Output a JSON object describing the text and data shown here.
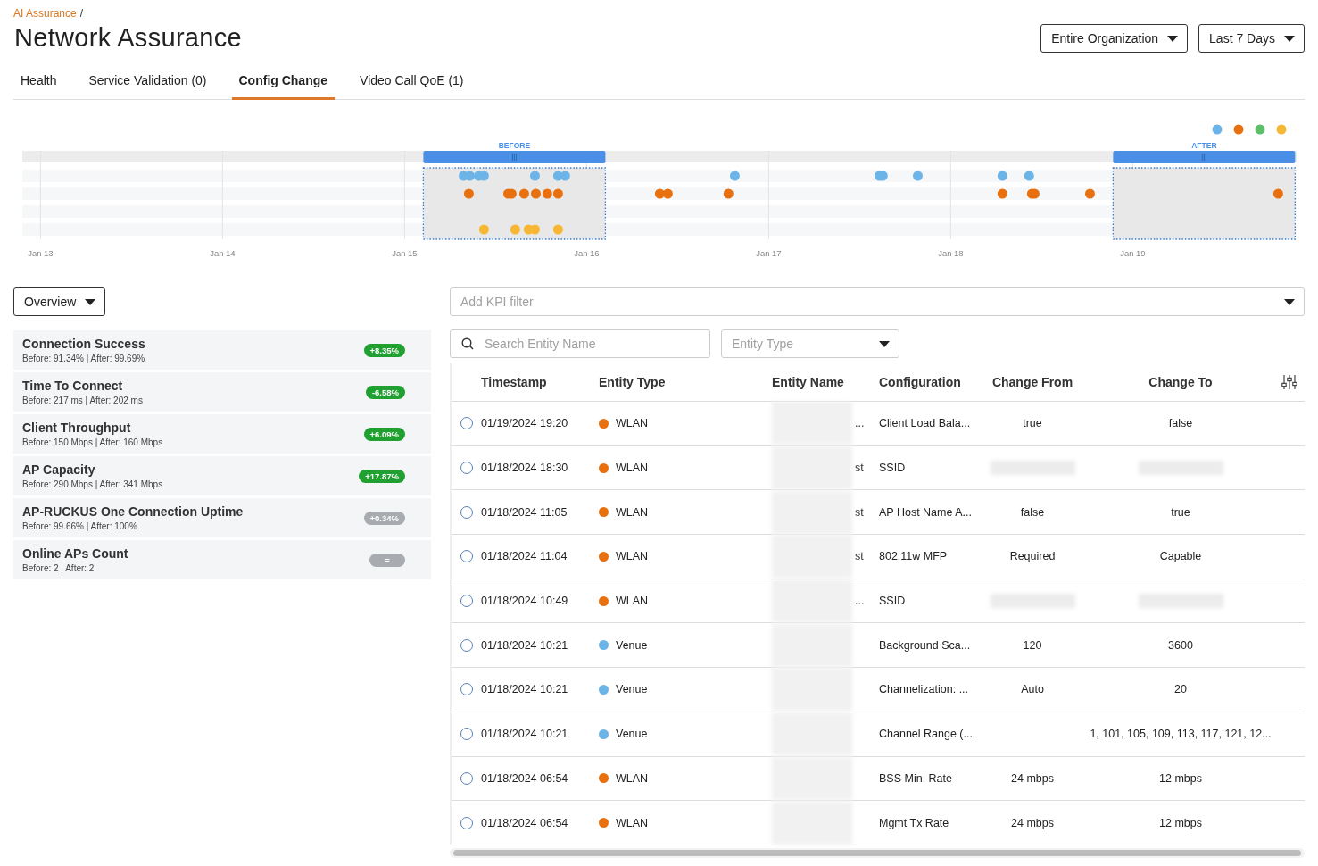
{
  "breadcrumb": {
    "link": "AI Assurance",
    "separator": "/"
  },
  "title": "Network Assurance",
  "scope_dropdowns": [
    {
      "label": "Entire Organization"
    },
    {
      "label": "Last 7 Days"
    }
  ],
  "tabs": [
    {
      "label": "Health",
      "selected": false
    },
    {
      "label": "Service Validation (0)",
      "selected": false
    },
    {
      "label": "Config Change",
      "selected": true
    },
    {
      "label": "Video Call QoE (1)",
      "selected": false
    }
  ],
  "timeline": {
    "legend": [
      {
        "color": "#6cb4e8"
      },
      {
        "color": "#e8700f"
      },
      {
        "color": "#5cbf6a"
      },
      {
        "color": "#f7b733"
      }
    ],
    "tick_labels": [
      "Jan 13",
      "Jan 14",
      "Jan 15",
      "Jan 16",
      "Jan 17",
      "Jan 18",
      "Jan 19"
    ],
    "ranges": [
      {
        "label": "BEFORE"
      },
      {
        "label": "AFTER"
      }
    ]
  },
  "view_dropdown": {
    "label": "Overview"
  },
  "kpis": [
    {
      "name": "Connection Success",
      "detail": "Before: 91.34% | After: 99.69%",
      "change": "+8.35%",
      "kind": "positive"
    },
    {
      "name": "Time To Connect",
      "detail": "Before: 217 ms | After: 202 ms",
      "change": "-6.58%",
      "kind": "positive"
    },
    {
      "name": "Client Throughput",
      "detail": "Before: 150 Mbps | After: 160 Mbps",
      "change": "+6.09%",
      "kind": "positive"
    },
    {
      "name": "AP Capacity",
      "detail": "Before: 290 Mbps | After: 341 Mbps",
      "change": "+17.87%",
      "kind": "positive"
    },
    {
      "name": "AP-RUCKUS One Connection Uptime",
      "detail": "Before: 99.66% | After: 100%",
      "change": "+0.34%",
      "kind": "neutral"
    },
    {
      "name": "Online APs Count",
      "detail": "Before: 2 | After: 2",
      "change": "=",
      "kind": "neutral"
    }
  ],
  "kpi_filter": {
    "placeholder": "Add KPI filter"
  },
  "search": {
    "placeholder": "Search Entity Name"
  },
  "entity_type_filter": {
    "placeholder": "Entity Type"
  },
  "table": {
    "columns": [
      "Timestamp",
      "Entity Type",
      "Entity Name",
      "Configuration",
      "Change From",
      "Change To"
    ],
    "rows": [
      {
        "selected": false,
        "timestamp": "01/19/2024 19:20",
        "entity_type": "WLAN",
        "color": "#e8700f",
        "entity_name_tail": "...",
        "configuration": "Client Load Bala...",
        "change_from": {
          "kind": "text",
          "text": "true"
        },
        "change_to": {
          "kind": "text",
          "text": "false"
        }
      },
      {
        "selected": false,
        "timestamp": "01/18/2024 18:30",
        "entity_type": "WLAN",
        "color": "#e8700f",
        "entity_name_tail": "st",
        "configuration": "SSID",
        "change_from": {
          "kind": "redacted"
        },
        "change_to": {
          "kind": "redacted"
        }
      },
      {
        "selected": false,
        "timestamp": "01/18/2024 11:05",
        "entity_type": "WLAN",
        "color": "#e8700f",
        "entity_name_tail": "st",
        "configuration": "AP Host Name A...",
        "change_from": {
          "kind": "text",
          "text": "false"
        },
        "change_to": {
          "kind": "text",
          "text": "true"
        }
      },
      {
        "selected": false,
        "timestamp": "01/18/2024 11:04",
        "entity_type": "WLAN",
        "color": "#e8700f",
        "entity_name_tail": "st",
        "configuration": "802.11w MFP",
        "change_from": {
          "kind": "text",
          "text": "Required"
        },
        "change_to": {
          "kind": "text",
          "text": "Capable"
        }
      },
      {
        "selected": false,
        "timestamp": "01/18/2024 10:49",
        "entity_type": "WLAN",
        "color": "#e8700f",
        "entity_name_tail": "...",
        "configuration": "SSID",
        "change_from": {
          "kind": "redacted"
        },
        "change_to": {
          "kind": "redacted"
        }
      },
      {
        "selected": false,
        "timestamp": "01/18/2024 10:21",
        "entity_type": "Venue",
        "color": "#6cb4e8",
        "configuration": "Background Sca...",
        "change_from": {
          "kind": "text",
          "text": "120"
        },
        "change_to": {
          "kind": "text",
          "text": "3600"
        }
      },
      {
        "selected": false,
        "timestamp": "01/18/2024 10:21",
        "entity_type": "Venue",
        "color": "#6cb4e8",
        "configuration": "Channelization: ...",
        "change_from": {
          "kind": "text",
          "text": "Auto"
        },
        "change_to": {
          "kind": "text",
          "text": "20"
        }
      },
      {
        "selected": false,
        "timestamp": "01/18/2024 10:21",
        "entity_type": "Venue",
        "color": "#6cb4e8",
        "configuration": "Channel Range (...",
        "change_to": {
          "kind": "text",
          "text": "1, 101, 105, 109, 113, 117, 121, 12..."
        }
      },
      {
        "selected": false,
        "timestamp": "01/18/2024 06:54",
        "entity_type": "WLAN",
        "color": "#e8700f",
        "configuration": "BSS Min. Rate",
        "change_from": {
          "kind": "text",
          "text": "24 mbps"
        },
        "change_to": {
          "kind": "text",
          "text": "12 mbps"
        }
      },
      {
        "selected": false,
        "timestamp": "01/18/2024 06:54",
        "entity_type": "WLAN",
        "color": "#e8700f",
        "configuration": "Mgmt Tx Rate",
        "change_from": {
          "kind": "text",
          "text": "24 mbps"
        },
        "change_to": {
          "kind": "text",
          "text": "12 mbps"
        }
      }
    ]
  }
}
